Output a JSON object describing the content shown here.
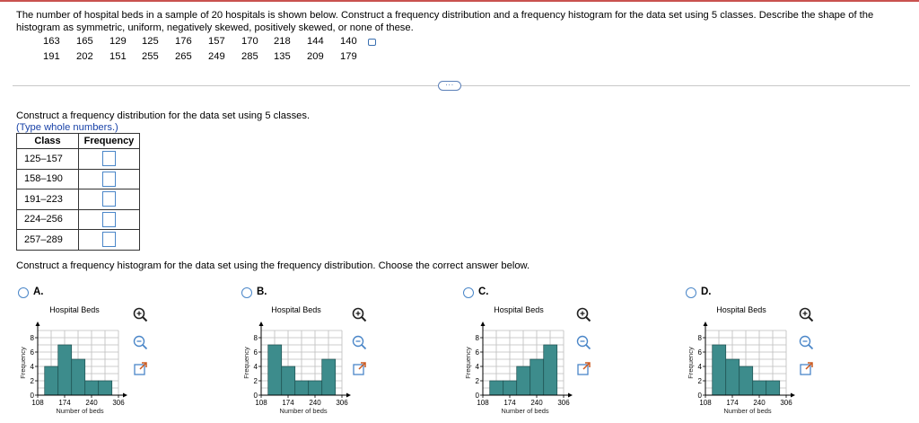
{
  "question": {
    "text": "The number of hospital beds in a sample of 20 hospitals is shown below. Construct a frequency distribution and a frequency histogram for the data set using 5 classes. Describe the shape of the histogram as symmetric, uniform, negatively skewed, positively skewed, or none of these.",
    "data_row1": [
      "163",
      "165",
      "129",
      "125",
      "176",
      "157",
      "170",
      "218",
      "144",
      "140"
    ],
    "data_row2": [
      "191",
      "202",
      "151",
      "255",
      "265",
      "249",
      "285",
      "135",
      "209",
      "179"
    ]
  },
  "more_button_label": "···",
  "part1": {
    "instruction": "Construct a frequency distribution for the data set using 5 classes.",
    "hint": "(Type whole numbers.)",
    "table": {
      "headers": [
        "Class",
        "Frequency"
      ],
      "classes": [
        "125–157",
        "158–190",
        "191–223",
        "224–256",
        "257–289"
      ]
    }
  },
  "part2": {
    "instruction": "Construct a frequency histogram for the data set using the frequency distribution. Choose the correct answer below."
  },
  "options": [
    {
      "letter": "A.",
      "chart_title": "Hospital Beds"
    },
    {
      "letter": "B.",
      "chart_title": "Hospital Beds"
    },
    {
      "letter": "C.",
      "chart_title": "Hospital Beds"
    },
    {
      "letter": "D.",
      "chart_title": "Hospital Beds"
    }
  ],
  "colors": {
    "bar": "#3d8c8c",
    "grid": "#bdbdbd",
    "accent": "#4a86c8",
    "link": "#1a43a8"
  },
  "icons": [
    "zoom-in-icon",
    "zoom-out-icon",
    "pop-out-icon",
    "copy-data-icon"
  ],
  "chart_data": [
    {
      "type": "bar",
      "title": "Hospital Beds",
      "xlabel": "Number of beds",
      "ylabel": "Frequency",
      "x_ticks": [
        "108",
        "174",
        "240",
        "306"
      ],
      "y_ticks": [
        "0",
        "2",
        "4",
        "6",
        "8"
      ],
      "bin_edges": [
        108,
        141,
        174,
        207,
        240,
        273,
        306
      ],
      "ylim": [
        0,
        9
      ],
      "series": [
        {
          "values": [
            4,
            7,
            5,
            2,
            2
          ]
        }
      ],
      "x_start": 125,
      "bin_width": 33
    },
    {
      "type": "bar",
      "title": "Hospital Beds",
      "xlabel": "Number of beds",
      "ylabel": "Frequency",
      "x_ticks": [
        "108",
        "174",
        "240",
        "306"
      ],
      "y_ticks": [
        "0",
        "2",
        "4",
        "6",
        "8"
      ],
      "bin_edges": [
        108,
        141,
        174,
        207,
        240,
        273,
        306
      ],
      "ylim": [
        0,
        9
      ],
      "series": [
        {
          "values": [
            7,
            4,
            2,
            2,
            5
          ]
        }
      ],
      "x_start": 125,
      "bin_width": 33
    },
    {
      "type": "bar",
      "title": "Hospital Beds",
      "xlabel": "Number of beds",
      "ylabel": "Frequency",
      "x_ticks": [
        "108",
        "174",
        "240",
        "306"
      ],
      "y_ticks": [
        "0",
        "2",
        "4",
        "6",
        "8"
      ],
      "bin_edges": [
        108,
        141,
        174,
        207,
        240,
        273,
        306
      ],
      "ylim": [
        0,
        9
      ],
      "series": [
        {
          "values": [
            2,
            2,
            4,
            5,
            7
          ]
        }
      ],
      "x_start": 125,
      "bin_width": 33
    },
    {
      "type": "bar",
      "title": "Hospital Beds",
      "xlabel": "Number of beds",
      "ylabel": "Frequency",
      "x_ticks": [
        "108",
        "174",
        "240",
        "306"
      ],
      "y_ticks": [
        "0",
        "2",
        "4",
        "6",
        "8"
      ],
      "bin_edges": [
        108,
        141,
        174,
        207,
        240,
        273,
        306
      ],
      "ylim": [
        0,
        9
      ],
      "series": [
        {
          "values": [
            7,
            5,
            4,
            2,
            2
          ]
        }
      ],
      "x_start": 125,
      "bin_width": 33
    }
  ]
}
